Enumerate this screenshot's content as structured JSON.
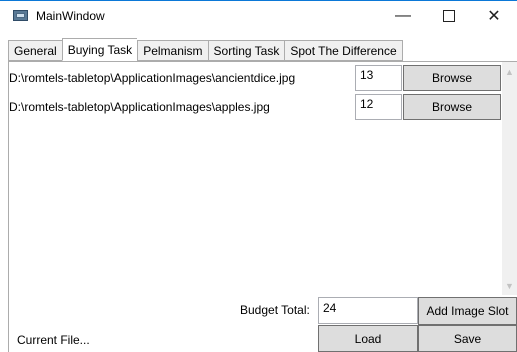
{
  "window": {
    "title": "MainWindow"
  },
  "titlebar": {
    "minimize_glyph": "—",
    "close_glyph": "✕"
  },
  "tabs": [
    {
      "label": "General"
    },
    {
      "label": "Buying Task",
      "active": true
    },
    {
      "label": "Pelmanism"
    },
    {
      "label": "Sorting Task"
    },
    {
      "label": "Spot The Difference"
    }
  ],
  "image_slots": [
    {
      "path": "D:\\romtels-tabletop\\ApplicationImages\\ancientdice.jpg",
      "quantity": "13",
      "browse_label": "Browse"
    },
    {
      "path": "D:\\romtels-tabletop\\ApplicationImages\\apples.jpg",
      "quantity": "12",
      "browse_label": "Browse"
    }
  ],
  "scrollbar": {
    "up_glyph": "▲",
    "down_glyph": "▼"
  },
  "footer": {
    "budget_label": "Budget Total:",
    "budget_value": "24",
    "add_slot_label": "Add Image Slot",
    "current_file_label": "Current File...",
    "load_label": "Load",
    "save_label": "Save"
  }
}
